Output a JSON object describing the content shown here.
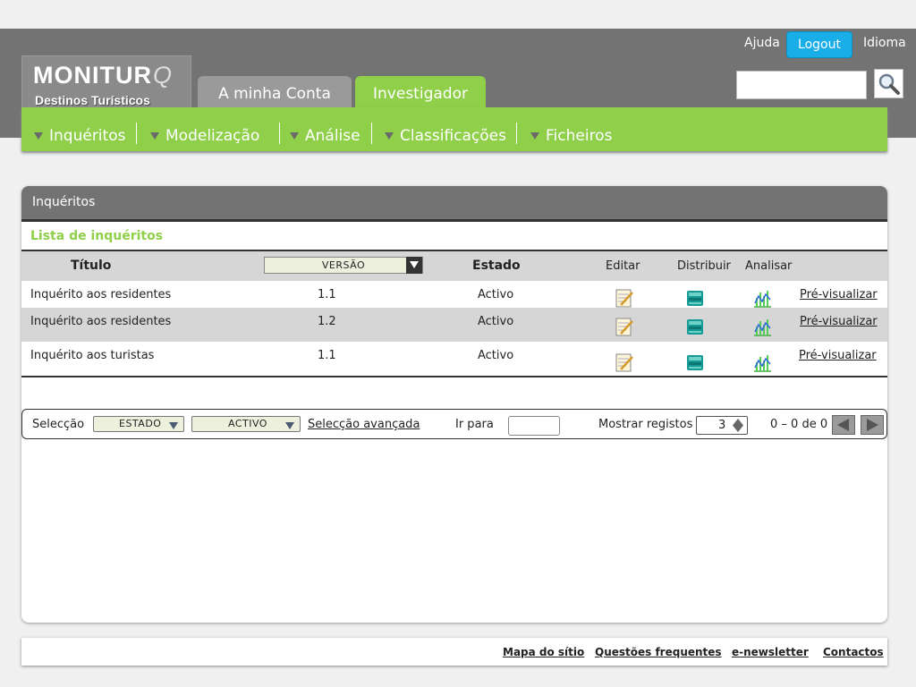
{
  "brand": {
    "logo_main": "MONITUR",
    "logo_q": "Q",
    "logo_sub": "Destinos Turísticos"
  },
  "header": {
    "tabs": [
      {
        "label": "A minha Conta",
        "active": false
      },
      {
        "label": "Investigador",
        "active": true
      }
    ],
    "links": {
      "ajuda": "Ajuda",
      "logout": "Logout",
      "idioma": "Idioma"
    },
    "search_icon": "magnifier-icon"
  },
  "menu": {
    "items": [
      {
        "label": "Inquéritos"
      },
      {
        "label": "Modelização"
      },
      {
        "label": "Análise"
      },
      {
        "label": "Classificações"
      },
      {
        "label": "Ficheiros"
      }
    ]
  },
  "panel": {
    "title": "Inquéritos",
    "list_title": "Lista de inquéritos",
    "columns": {
      "titulo": "Título",
      "versao": "VERSÃO",
      "estado": "Estado",
      "editar": "Editar",
      "distribuir": "Distribuir",
      "analisar": "Analisar"
    },
    "rows": [
      {
        "titulo": "Inquérito aos residentes",
        "versao": "1.1",
        "estado": "Activo",
        "preview": "Pré-visualizar"
      },
      {
        "titulo": "Inquérito aos residentes",
        "versao": "1.2",
        "estado": "Activo",
        "preview": "Pré-visualizar"
      },
      {
        "titulo": "Inquérito aos turistas",
        "versao": "1.1",
        "estado": "Activo",
        "preview": "Pré-visualizar"
      }
    ],
    "row_icons": {
      "edit": "notepad-edit-icon",
      "distribute": "book-stack-icon",
      "analyse": "bar-chart-icon"
    }
  },
  "filter": {
    "selection_label": "Selecção",
    "field_select": "ESTADO",
    "value_select": "ACTIVO",
    "advanced_link": "Selecção avançada",
    "goto_label": "Ir para",
    "show_label": "Mostrar registos",
    "show_value": "3",
    "range_text": "0 – 0  de 0"
  },
  "footer": {
    "links": [
      "Mapa do sítio",
      "Questões frequentes",
      "e-newsletter",
      "Contactos"
    ]
  },
  "colors": {
    "green": "#8fcf4a",
    "gray": "#737373",
    "blue": "#19aee8"
  }
}
